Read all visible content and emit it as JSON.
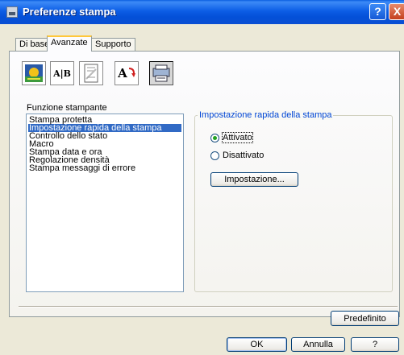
{
  "window": {
    "title": "Preferenze stampa",
    "help_glyph": "?",
    "close_glyph": "X"
  },
  "tabs": [
    {
      "label": "Di base",
      "active": false
    },
    {
      "label": "Avanzate",
      "active": true
    },
    {
      "label": "Supporto",
      "active": false
    }
  ],
  "toolbar": {
    "icons": [
      {
        "name": "print-quality-icon",
        "selected": false
      },
      {
        "name": "duplex-icon",
        "text": "A|B",
        "selected": false
      },
      {
        "name": "watermark-icon",
        "selected": false
      },
      {
        "name": "page-setting-icon",
        "text": "A",
        "selected": false
      },
      {
        "name": "device-options-icon",
        "selected": true
      }
    ]
  },
  "feature_list": {
    "label": "Funzione stampante",
    "items": [
      "Stampa protetta",
      "Impostazione rapida della stampa",
      "Controllo dello stato",
      "Macro",
      "Stampa data e ora",
      "Regolazione densità",
      "Stampa messaggi di errore"
    ],
    "selected_index": 1
  },
  "group": {
    "title": "Impostazione rapida della stampa",
    "option_on": "Attivato",
    "option_off": "Disattivato",
    "selected": "Attivato",
    "settings_button": "Impostazione..."
  },
  "buttons": {
    "default": "Predefinito",
    "ok": "OK",
    "cancel": "Annulla",
    "help": "?"
  },
  "colors": {
    "titlebar": "#0a5fe0",
    "selection": "#316ac5",
    "group_title": "#0046d5"
  }
}
